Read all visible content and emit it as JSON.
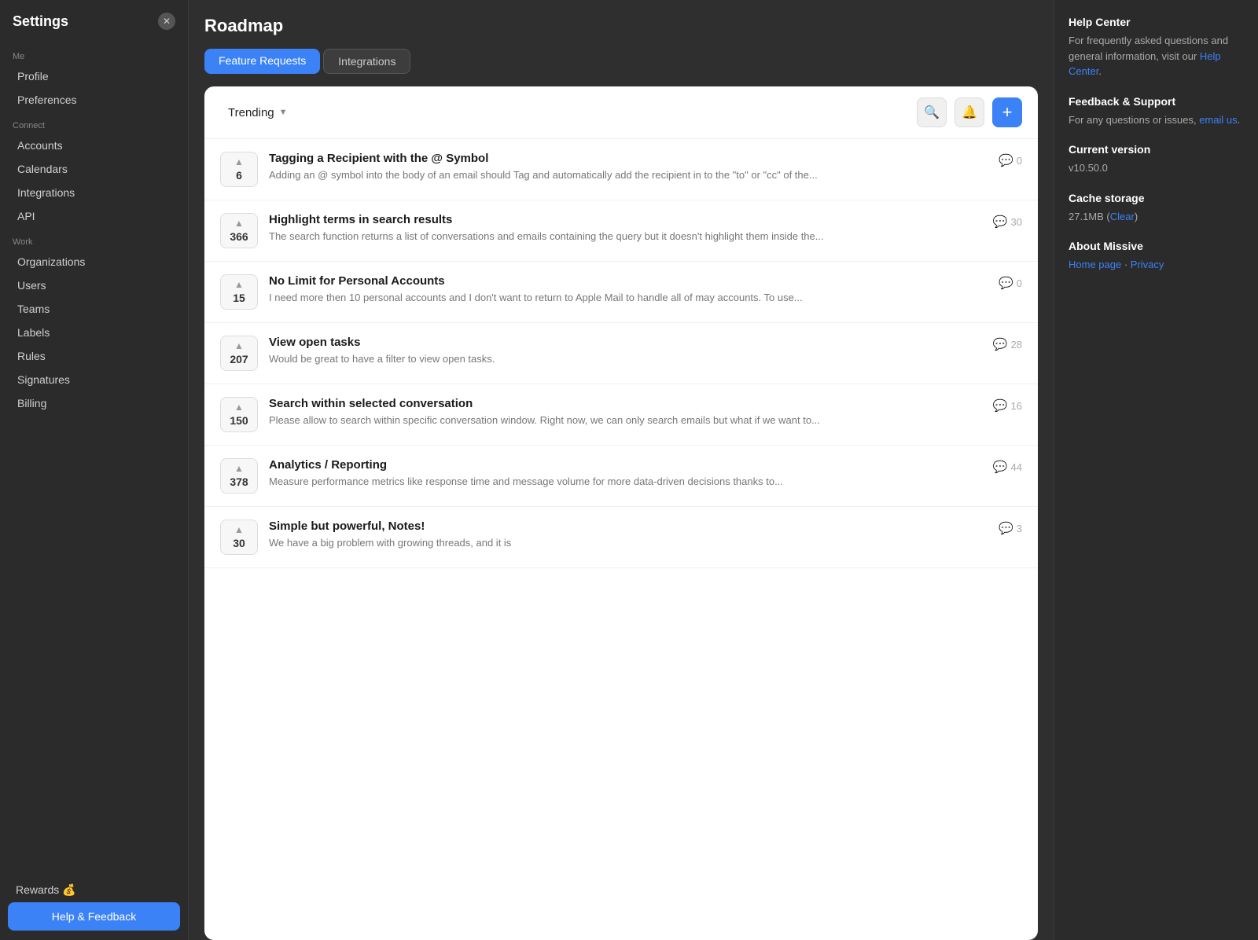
{
  "sidebar": {
    "title": "Settings",
    "close_label": "✕",
    "me_section": "Me",
    "connect_section": "Connect",
    "work_section": "Work",
    "items_me": [
      {
        "id": "profile",
        "label": "Profile"
      },
      {
        "id": "preferences",
        "label": "Preferences"
      }
    ],
    "items_connect": [
      {
        "id": "accounts",
        "label": "Accounts"
      },
      {
        "id": "calendars",
        "label": "Calendars"
      },
      {
        "id": "integrations",
        "label": "Integrations"
      },
      {
        "id": "api",
        "label": "API"
      }
    ],
    "items_work": [
      {
        "id": "organizations",
        "label": "Organizations"
      },
      {
        "id": "users",
        "label": "Users"
      },
      {
        "id": "teams",
        "label": "Teams"
      },
      {
        "id": "labels",
        "label": "Labels"
      },
      {
        "id": "rules",
        "label": "Rules"
      },
      {
        "id": "signatures",
        "label": "Signatures"
      },
      {
        "id": "billing",
        "label": "Billing"
      }
    ],
    "rewards_label": "Rewards 💰",
    "help_feedback_label": "Help & Feedback"
  },
  "main": {
    "page_title": "Roadmap",
    "tabs": [
      {
        "id": "feature-requests",
        "label": "Feature Requests",
        "active": true
      },
      {
        "id": "integrations",
        "label": "Integrations",
        "active": false
      }
    ],
    "sort_label": "Trending",
    "add_btn_label": "+",
    "features": [
      {
        "id": 1,
        "votes": 6,
        "title": "Tagging a Recipient with the @ Symbol",
        "desc": "Adding an @ symbol into the body of an email should Tag and automatically add the recipient in to the \"to\" or \"cc\" of the...",
        "comments": 0
      },
      {
        "id": 2,
        "votes": 366,
        "title": "Highlight terms in search results",
        "desc": "The search function returns a list of conversations and emails containing the query but it doesn't highlight them inside the...",
        "comments": 30
      },
      {
        "id": 3,
        "votes": 15,
        "title": "No Limit for Personal Accounts",
        "desc": "I need more then 10 personal accounts and I don't want to return to Apple Mail to handle all of may accounts. To use...",
        "comments": 0
      },
      {
        "id": 4,
        "votes": 207,
        "title": "View open tasks",
        "desc": "Would be great to have a filter to view open tasks.",
        "comments": 28
      },
      {
        "id": 5,
        "votes": 150,
        "title": "Search within selected conversation",
        "desc": "Please allow to search within specific conversation window. Right now, we can only search emails but what if we want to...",
        "comments": 16
      },
      {
        "id": 6,
        "votes": 378,
        "title": "Analytics / Reporting",
        "desc": "Measure performance metrics like response time and message volume for more data-driven decisions thanks to...",
        "comments": 44
      },
      {
        "id": 7,
        "votes": 30,
        "title": "Simple but powerful, Notes!",
        "desc": "We have a big problem with growing threads, and it is",
        "comments": 3
      }
    ]
  },
  "right_panel": {
    "help_center": {
      "title": "Help Center",
      "text": "For frequently asked questions and general information, visit our ",
      "link_label": "Help Center",
      "link_suffix": "."
    },
    "feedback_support": {
      "title": "Feedback & Support",
      "text": "For any questions or issues, ",
      "link_label": "email us",
      "link_suffix": "."
    },
    "current_version": {
      "title": "Current version",
      "value": "v10.50.0"
    },
    "cache_storage": {
      "title": "Cache storage",
      "size": "27.1MB",
      "clear_label": "Clear"
    },
    "about": {
      "title": "About Missive",
      "home_label": "Home page",
      "privacy_label": "Privacy"
    }
  }
}
